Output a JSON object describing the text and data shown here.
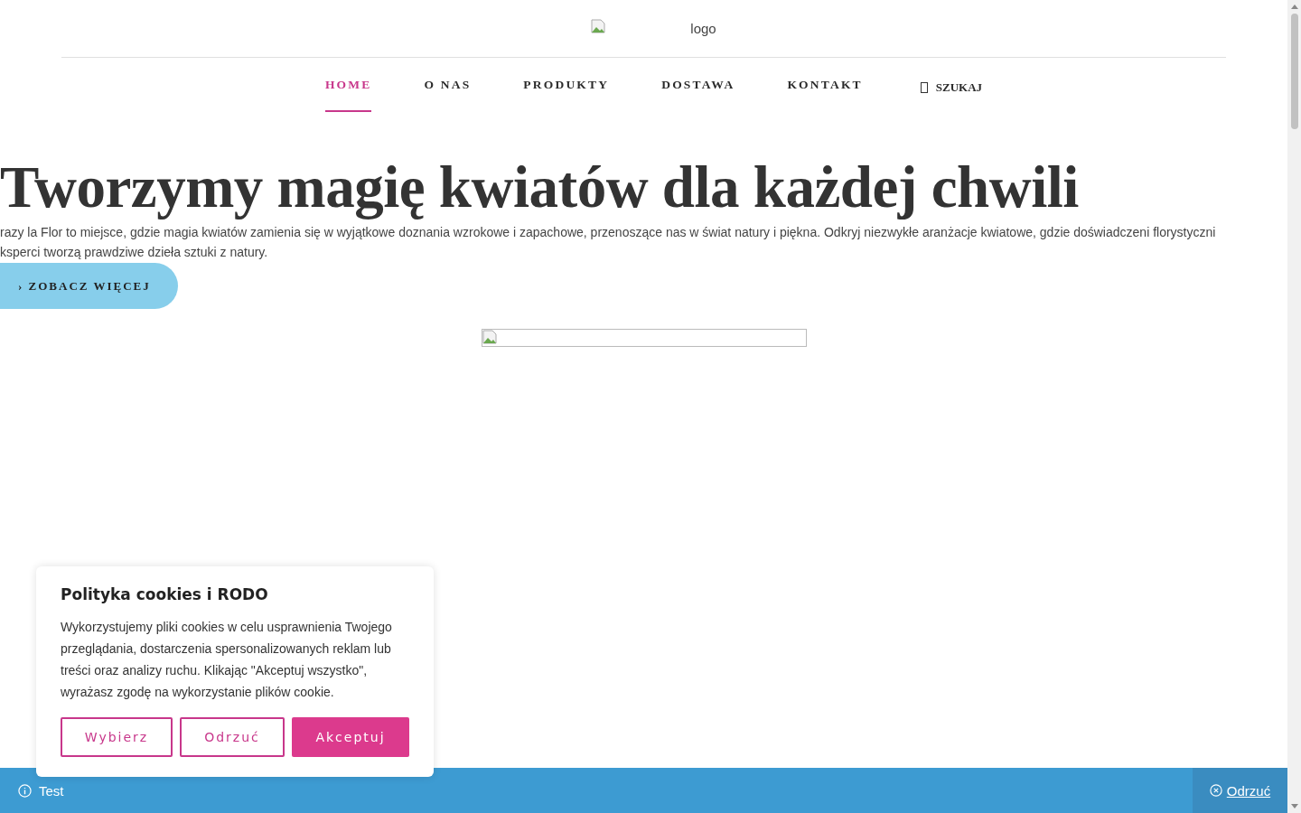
{
  "header": {
    "logo": {
      "alt": "logo"
    }
  },
  "nav": {
    "items": [
      {
        "label": "HOME",
        "selected": true
      },
      {
        "label": "O NAS",
        "selected": false
      },
      {
        "label": "PRODUKTY",
        "selected": false
      },
      {
        "label": "DOSTAWA",
        "selected": false
      },
      {
        "label": "KONTAKT",
        "selected": false
      }
    ],
    "search": {
      "label": "SZUKAJ"
    }
  },
  "hero": {
    "title": "Tworzymy magię kwiatów dla każdej chwili",
    "lines": [
      "razy la Flor to miejsce, gdzie magia kwiatów zamienia się w wyjątkowe doznania wzrokowe i zapachowe, przenoszące nas w świat natury i piękna. Odkryj niezwykłe aranżacje kwiatowe, gdzie doświadczeni florystyczni",
      "ksperci tworzą prawdziwe dzieła sztuki z natury."
    ],
    "button": "› ZOBACZ WIĘCEJ"
  },
  "cookie_dialog": {
    "title": "Polityka cookies i RODO",
    "text": "Wykorzystujemy pliki cookies w celu usprawnienia Twojego przeglądania, dostarczenia spersonalizowanych reklam lub treści oraz analizy ruchu. Klikając \"Akceptuj wszystko\", wyrażasz zgodę na wykorzystanie plików cookie.",
    "buttons": [
      {
        "label": "Wybierz",
        "kind": "outline"
      },
      {
        "label": "Odrzuć",
        "kind": "outline"
      },
      {
        "label": "Akceptuj",
        "kind": "filled"
      }
    ]
  },
  "notice_bar": {
    "text": "Test",
    "dismiss": "Odrzuć"
  }
}
